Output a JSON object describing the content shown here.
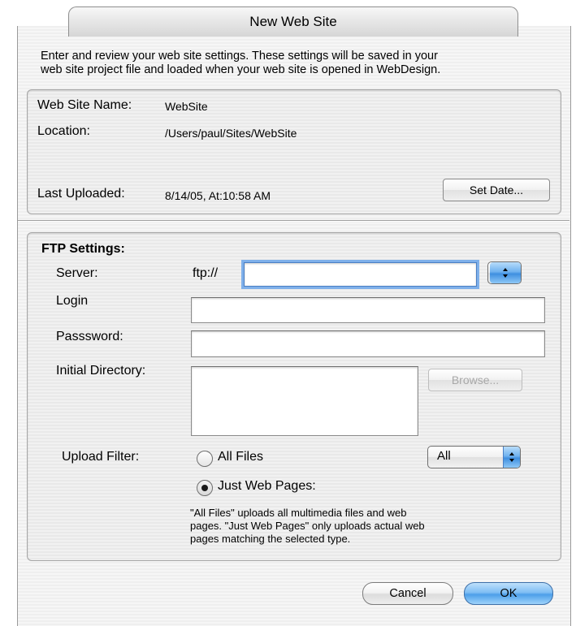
{
  "window": {
    "title": "New Web Site"
  },
  "intro": {
    "line1": "Enter and review your web site settings. These settings will be saved in your",
    "line2": "web site project file and loaded when your web site is opened in WebDesign."
  },
  "site": {
    "name_label": "Web Site Name:",
    "name_value": "WebSite",
    "location_label": "Location:",
    "location_value": "/Users/paul/Sites/WebSite",
    "uploaded_label": "Last Uploaded:",
    "uploaded_value": "8/14/05, At:10:58 AM",
    "set_date_button": "Set Date..."
  },
  "ftp": {
    "section_title": "FTP Settings:",
    "server_label": "Server:",
    "server_prefix": "ftp://",
    "server_value": "",
    "login_label": "Login",
    "login_value": "",
    "password_label": "Passsword:",
    "password_value": "",
    "directory_label": "Initial Directory:",
    "directory_value": "",
    "browse_button": "Browse..."
  },
  "upload": {
    "filter_label": "Upload Filter:",
    "option_all": "All Files",
    "option_web": "Just Web Pages:",
    "selected": "Just Web Pages:",
    "type_select": "All",
    "note_line1": "\"All Files\" uploads all multimedia files and web",
    "note_line2": "pages. \"Just Web Pages\" only uploads actual web",
    "note_line3": "pages matching the selected type."
  },
  "buttons": {
    "cancel": "Cancel",
    "ok": "OK"
  },
  "colors": {
    "accent": "#4d9fe9",
    "focus_ring": "#7fb0ea"
  }
}
